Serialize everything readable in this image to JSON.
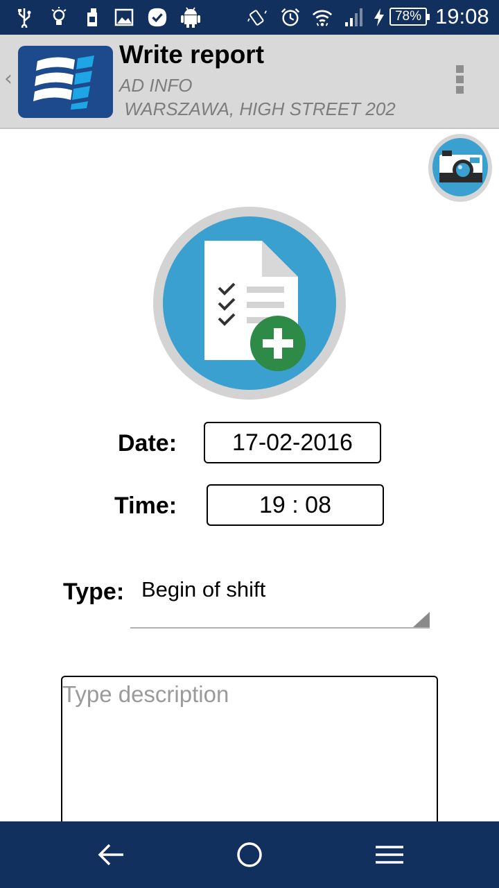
{
  "status_bar": {
    "battery": "78%",
    "time": "19:08",
    "icons": [
      "usb-icon",
      "lightbulb-icon",
      "sim-icon",
      "image-icon",
      "check-badge-icon",
      "android-icon",
      "vibrate-icon",
      "alarm-icon",
      "wifi-icon",
      "signal-icon",
      "charging-icon"
    ]
  },
  "action_bar": {
    "title": "Write report",
    "subtitle": "AD INFO",
    "address": " WARSZAWA, HIGH STREET 202"
  },
  "form": {
    "date_label": "Date:",
    "date_value": "17-02-2016",
    "time_label": "Time:",
    "time_value": "19 : 08",
    "type_label": "Type:",
    "type_value": "Begin of shift",
    "description_placeholder": "Type description"
  },
  "colors": {
    "system_bar": "#12305e",
    "action_bar": "#d9d9d9",
    "accent_blue": "#3aa0cf",
    "accent_green": "#2e8b47"
  }
}
